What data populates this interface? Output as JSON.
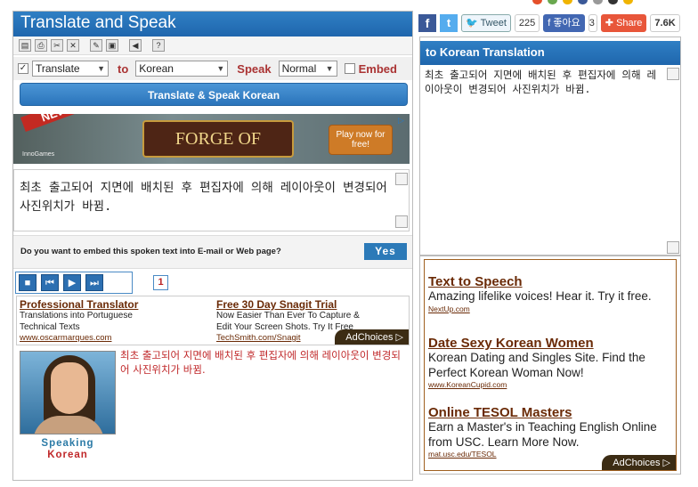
{
  "app": {
    "title": "Translate and Speak"
  },
  "toolbar": {
    "icons": [
      "new-doc-icon",
      "print-icon",
      "cut-icon",
      "delete-icon",
      "edit-icon",
      "paste-icon",
      "speaker-icon",
      "help-icon"
    ]
  },
  "controls": {
    "mode": "Translate",
    "to_label": "to",
    "target_lang": "Korean",
    "speak_label": "Speak",
    "speak_mode": "Normal",
    "embed_label": "Embed",
    "translate_checked": true,
    "embed_checked": false
  },
  "translate_button": "Translate & Speak Korean",
  "banner": {
    "new_tag": "NEW",
    "game_title": "FORGE OF EMPIRES",
    "cta": "Play now for free!",
    "publisher": "InnoGames"
  },
  "source_text": "최초 출고되어 지면에 배치된 후 편집자에 의해 레이아웃이 변경되어 사진위치가 바뀜.",
  "embed": {
    "question": "Do you want to embed this spoken text into E-mail or Web page?",
    "yes": "Yes"
  },
  "player": {
    "page": "1"
  },
  "text_ads": [
    {
      "title": "Professional Translator",
      "line1": "Translations into Portuguese",
      "line2": "Technical Texts",
      "url": "www.oscarmarques.com"
    },
    {
      "title": "Free 30 Day Snagit Trial",
      "line1": "Now Easier Than Ever To Capture &",
      "line2": "Edit Your Screen Shots. Try It Free",
      "url": "TechSmith.com/Snagit"
    }
  ],
  "adchoices": "AdChoices",
  "avatar": {
    "speaking": "Speaking",
    "language": "Korean"
  },
  "spoken_text": "최초 출고되어 지면에 배치된 후 편집자에 의해 레이아웃이 변경되어 사진위치가 바뀜.",
  "social": {
    "tweet": "Tweet",
    "tweet_count": "225",
    "like": "좋아요",
    "like_count": "3",
    "share": "Share",
    "share_count": "7.6K"
  },
  "right_panel": {
    "title": "to Korean Translation",
    "text": "최초 출고되어 지면에 배치된 후 편집자에 의해 레이아웃이 변경되어 사진위치가 바뀜."
  },
  "right_ads": [
    {
      "title": "Text to Speech",
      "body": "Amazing lifelike voices! Hear it. Try it free.",
      "url": "NextUp.com"
    },
    {
      "title": "Date Sexy Korean Women",
      "body": "Korean Dating and Singles Site. Find the Perfect Korean Woman Now!",
      "url": "www.KoreanCupid.com"
    },
    {
      "title": "Online TESOL Masters",
      "body": "Earn a Master's in Teaching English Online from USC. Learn More Now.",
      "url": "mat.usc.edu/TESOL"
    }
  ],
  "colors": {
    "header": "#1f66ad",
    "accent_red": "#c0282a",
    "ad_brown": "#6a2a06"
  }
}
